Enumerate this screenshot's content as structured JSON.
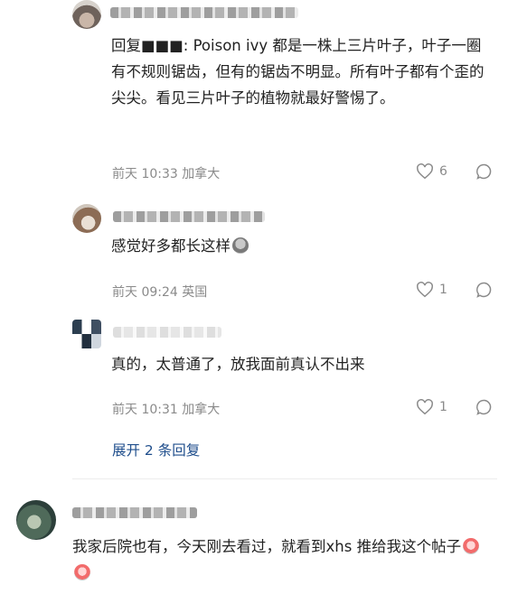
{
  "comments": [
    {
      "text": "回复■■■: Poison ivy 都是一株上三片叶子，叶子一圈有不规则锯齿，但有的锯齿不明显。所有叶子都有个歪的尖尖。看见三片叶子的植物就最好警惕了。",
      "time_location": "前天 10:33  加拿大",
      "likes": "6"
    },
    {
      "text": "感觉好多都长这样",
      "time_location": "前天 09:24  英国",
      "likes": "1"
    },
    {
      "text": "真的，太普通了，放我面前真认不出来",
      "time_location": "前天 10:31  加拿大",
      "likes": "1"
    }
  ],
  "expand_replies_label": "展开 2 条回复",
  "top_comment": {
    "text": "我家后院也有，今天刚去看过，就看到xhs 推给我这个帖子"
  },
  "colors": {
    "text": "#222222",
    "meta": "#8a8a8a",
    "link": "#1f4e8c"
  },
  "icons": [
    "heart-icon",
    "comment-icon"
  ]
}
